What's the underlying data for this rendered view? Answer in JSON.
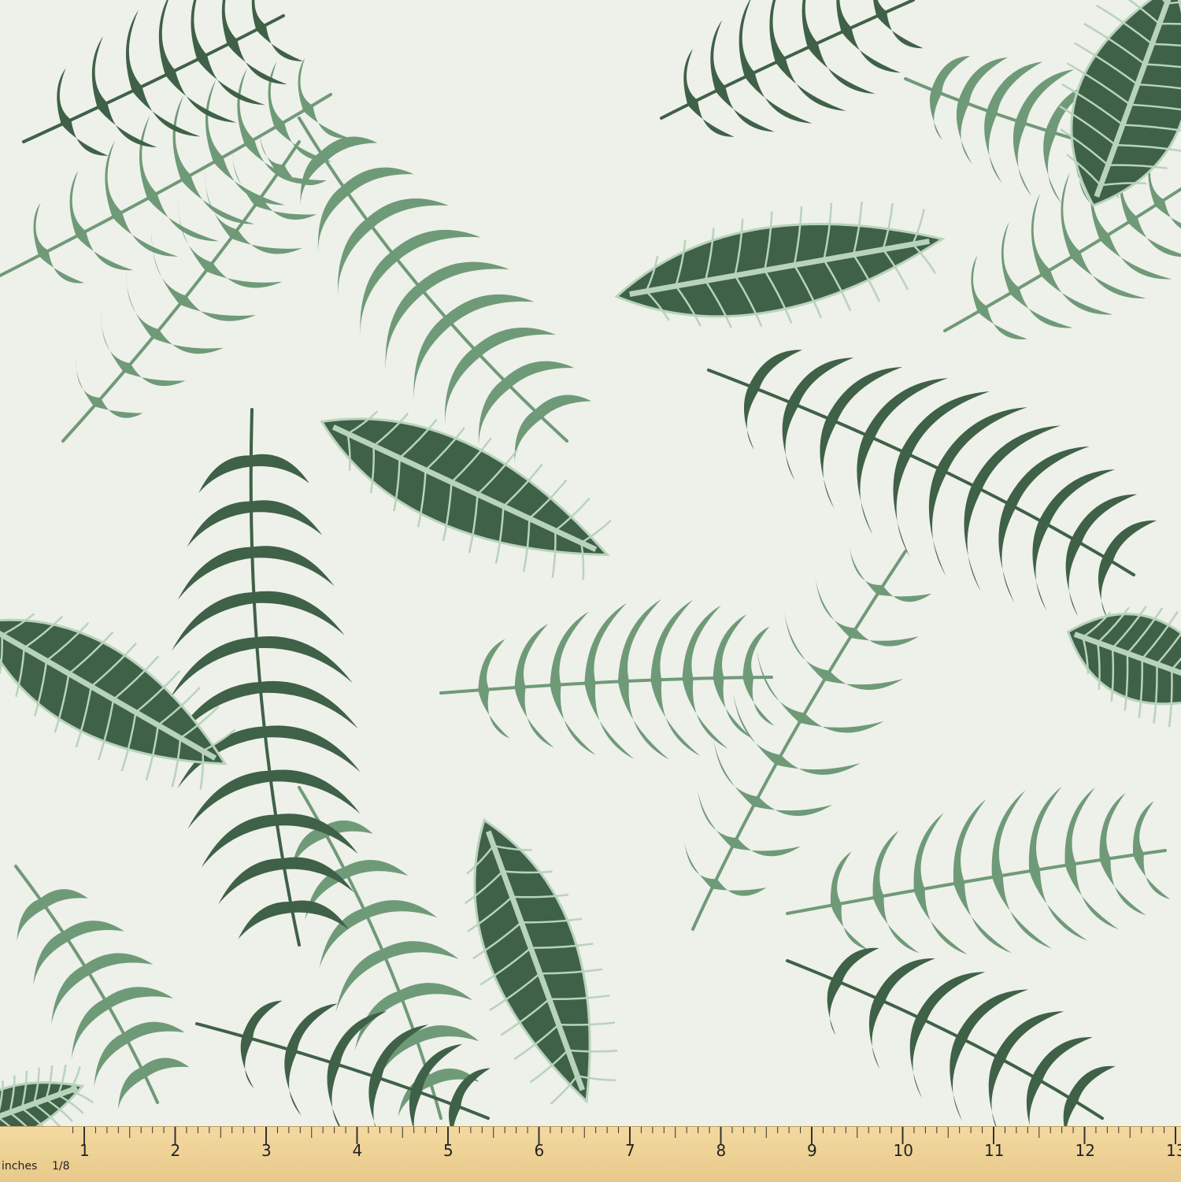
{
  "image": {
    "subject": "tropical leaf fabric swatch",
    "colors": {
      "background": "#eef0ea",
      "light_leaf": "#6f9a78",
      "dark_leaf": "#3f6147",
      "leaf_vein": "#b8d3bc",
      "ruler": "#f0d49a"
    }
  },
  "ruler": {
    "unit_label": "inches",
    "fraction_label": "1/8",
    "numbers": [
      "1",
      "2",
      "3",
      "4",
      "5",
      "6",
      "7",
      "8",
      "9",
      "10",
      "11",
      "12",
      "13"
    ]
  }
}
